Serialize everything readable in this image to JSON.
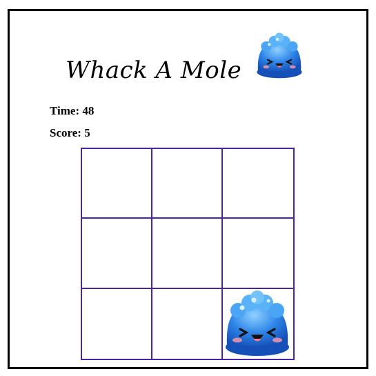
{
  "game": {
    "title": "Whack A Mole",
    "time_label": "Time: ",
    "time_value": "48",
    "score_label": "Score: ",
    "score_value": "5"
  },
  "board": {
    "rows": 3,
    "cols": 3,
    "mole_cell": {
      "row": 2,
      "col": 2
    }
  },
  "colors": {
    "frame": "#000000",
    "grid_lines": "#4b24a6",
    "mole_body": "#2f86e8",
    "mole_highlight": "#8fd0ff"
  },
  "icons": {
    "title_icon": "blue-jelly-mole-icon",
    "mole_icon": "blue-jelly-mole-icon"
  }
}
